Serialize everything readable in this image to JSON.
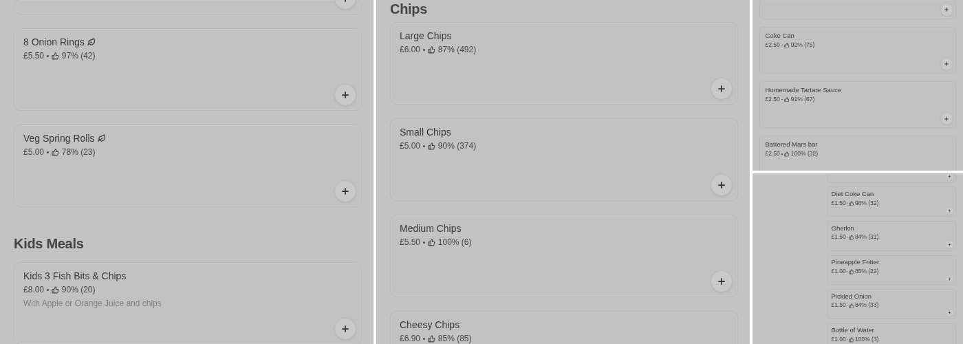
{
  "panels": [
    {
      "sections": [
        {
          "items": [
            {
              "kind": "cut"
            },
            {
              "kind": "item",
              "name": "8 Onion Rings",
              "vegetarian": true,
              "price": "£5.50",
              "rating": "97% (42)"
            },
            {
              "kind": "item",
              "name": "Veg Spring Rolls",
              "vegetarian": true,
              "price": "£5.00",
              "rating": "78% (23)"
            }
          ]
        },
        {
          "heading": "Kids Meals",
          "items": [
            {
              "kind": "item",
              "name": "Kids 3 Fish Bits & Chips",
              "vegetarian": false,
              "price": "£8.00",
              "rating": "90% (20)",
              "description": "With Apple or Orange Juice and chips"
            }
          ]
        }
      ]
    },
    {
      "sections": [
        {
          "heading": "Chips",
          "items": [
            {
              "kind": "item",
              "name": "Large Chips",
              "vegetarian": false,
              "price": "£6.00",
              "rating": "87% (492)"
            },
            {
              "kind": "item",
              "name": "Small Chips",
              "vegetarian": false,
              "price": "£5.00",
              "rating": "90% (374)"
            },
            {
              "kind": "item",
              "name": "Medium Chips",
              "vegetarian": false,
              "price": "£5.50",
              "rating": "100% (6)"
            },
            {
              "kind": "item_cut",
              "name": "Cheesy Chips",
              "vegetarian": false,
              "price": "£6.90",
              "rating": "85% (85)"
            }
          ]
        }
      ]
    },
    {
      "sections": [
        {
          "items": [
            {
              "kind": "cut"
            },
            {
              "kind": "item",
              "name": "Coke Can",
              "vegetarian": false,
              "price": "£2.50",
              "rating": "92% (75)"
            },
            {
              "kind": "item",
              "name": "Homemade Tartare Sauce",
              "vegetarian": false,
              "price": "£2.50",
              "rating": "91% (67)"
            },
            {
              "kind": "item_cut",
              "name": "Battered Mars bar",
              "vegetarian": false,
              "price": "£2.50",
              "rating": "100% (32)"
            }
          ]
        }
      ]
    },
    {
      "sections": [
        {
          "items": [
            {
              "kind": "cut"
            },
            {
              "kind": "item",
              "name": "Diet Coke Can",
              "vegetarian": false,
              "price": "£1.50",
              "rating": "98% (32)"
            },
            {
              "kind": "item",
              "name": "Gherkin",
              "vegetarian": false,
              "price": "£1.50",
              "rating": "84% (31)"
            },
            {
              "kind": "item",
              "name": "Pineapple Fritter",
              "vegetarian": false,
              "price": "£1.00",
              "rating": "85% (22)"
            },
            {
              "kind": "item",
              "name": "Pickled Onion",
              "vegetarian": false,
              "price": "£1.50",
              "rating": "84% (33)"
            },
            {
              "kind": "item_cut",
              "name": "Bottle of Water",
              "vegetarian": false,
              "price": "£1.00",
              "rating": "100% (3)"
            }
          ]
        }
      ]
    }
  ]
}
